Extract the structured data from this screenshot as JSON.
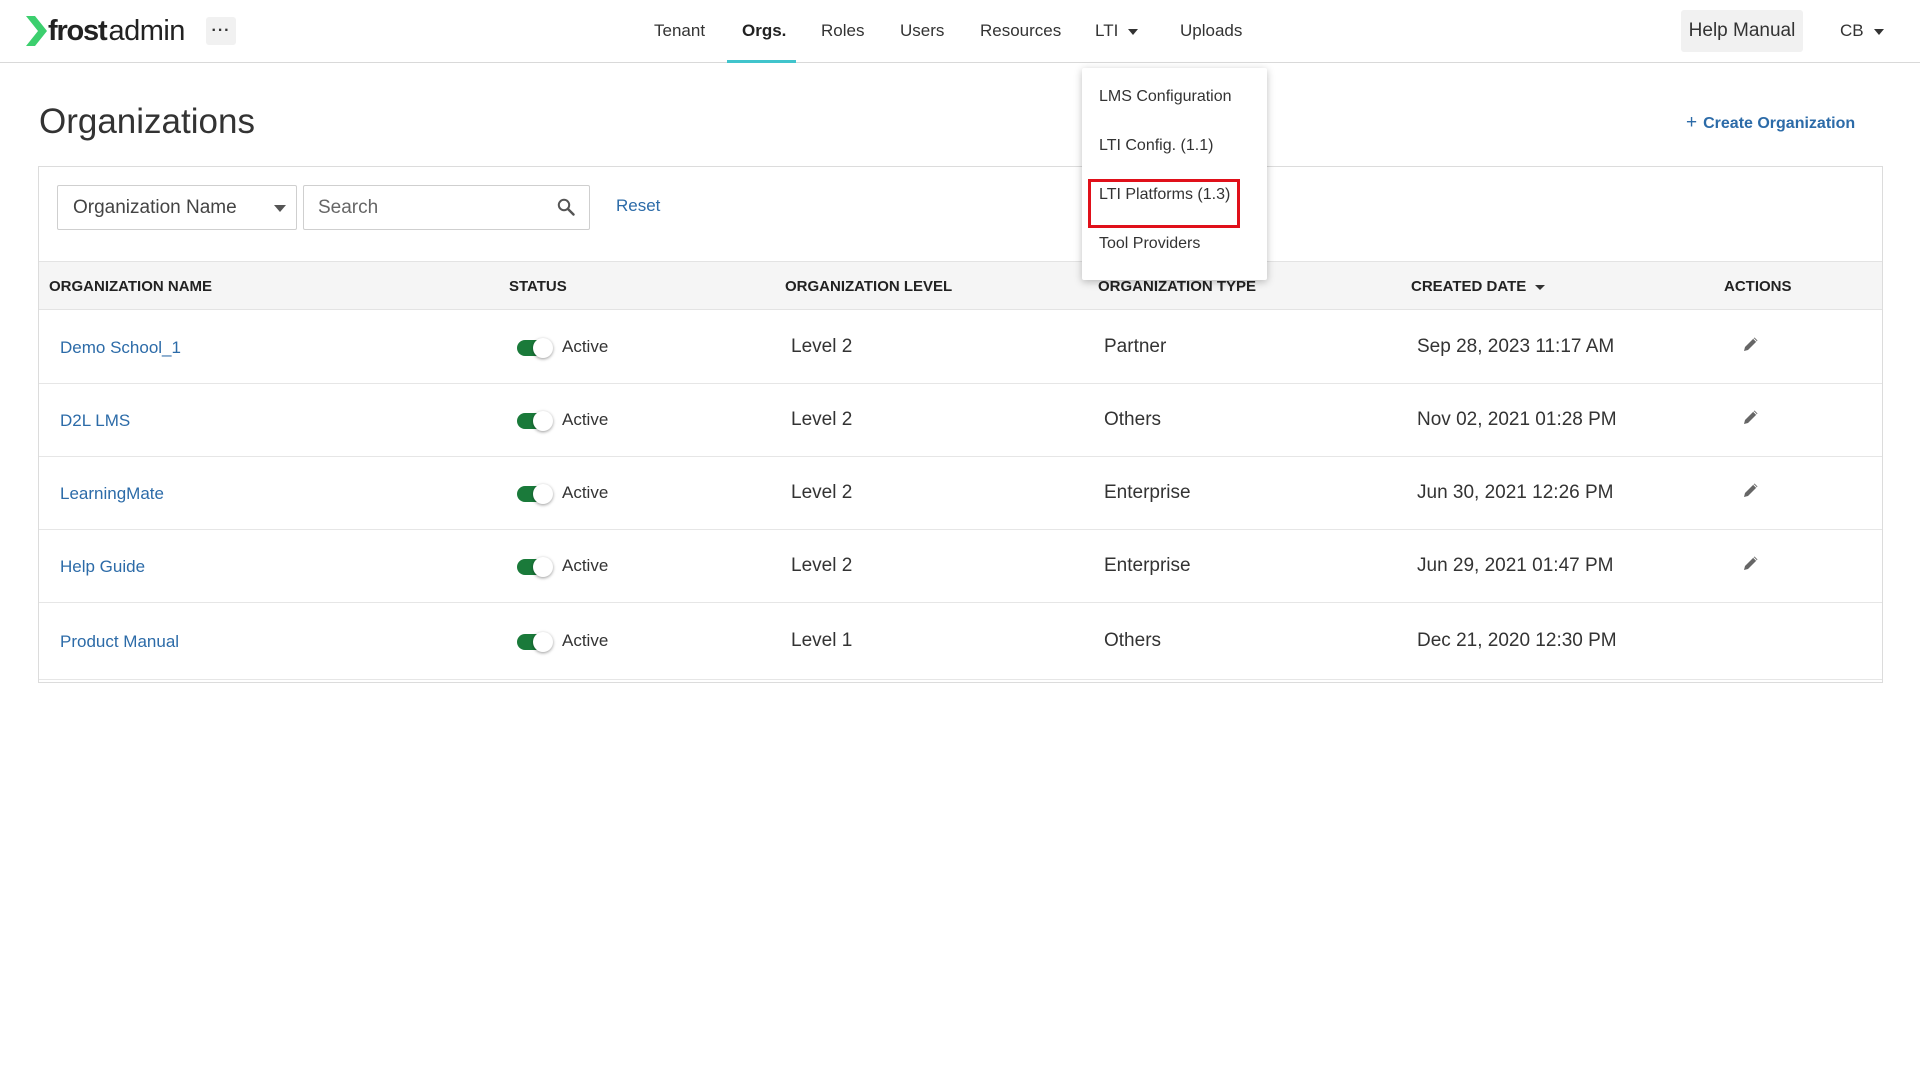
{
  "header": {
    "logo_bold": "frost",
    "logo_light": "admin",
    "more_label": "···",
    "nav": [
      {
        "label": "Tenant"
      },
      {
        "label": "Orgs."
      },
      {
        "label": "Roles"
      },
      {
        "label": "Users"
      },
      {
        "label": "Resources"
      },
      {
        "label": "LTI"
      },
      {
        "label": "Uploads"
      }
    ],
    "help_manual": "Help Manual",
    "user_initials": "CB"
  },
  "lti_menu": {
    "items": [
      {
        "label": "LMS Configuration"
      },
      {
        "label": "LTI Config. (1.1)"
      },
      {
        "label": "LTI Platforms (1.3)"
      },
      {
        "label": "Tool Providers"
      }
    ]
  },
  "page": {
    "title": "Organizations",
    "create_label": "Create Organization"
  },
  "filters": {
    "field_select": "Organization Name",
    "search_placeholder": "Search",
    "reset_label": "Reset"
  },
  "table": {
    "headers": [
      "ORGANIZATION NAME",
      "STATUS",
      "ORGANIZATION LEVEL",
      "ORGANIZATION TYPE",
      "CREATED DATE",
      "ACTIONS"
    ],
    "rows": [
      {
        "name": "Demo School_1",
        "status": "Active",
        "level": "Level 2",
        "type": "Partner",
        "created": "Sep 28, 2023 11:17 AM",
        "editable": true
      },
      {
        "name": "D2L LMS",
        "status": "Active",
        "level": "Level 2",
        "type": "Others",
        "created": "Nov 02, 2021 01:28 PM",
        "editable": true
      },
      {
        "name": "LearningMate",
        "status": "Active",
        "level": "Level 2",
        "type": "Enterprise",
        "created": "Jun 30, 2021 12:26 PM",
        "editable": true
      },
      {
        "name": "Help Guide",
        "status": "Active",
        "level": "Level 2",
        "type": "Enterprise",
        "created": "Jun 29, 2021 01:47 PM",
        "editable": true
      },
      {
        "name": "Product Manual",
        "status": "Active",
        "level": "Level 1",
        "type": "Others",
        "created": "Dec 21, 2020 12:30 PM",
        "editable": false
      }
    ]
  },
  "colors": {
    "link": "#2c6ba8",
    "toggle_on": "#1a7a3a",
    "nav_active_underline": "#40c4cc",
    "highlight_box": "#e0101a",
    "logo_green": "#3ccf6e"
  }
}
